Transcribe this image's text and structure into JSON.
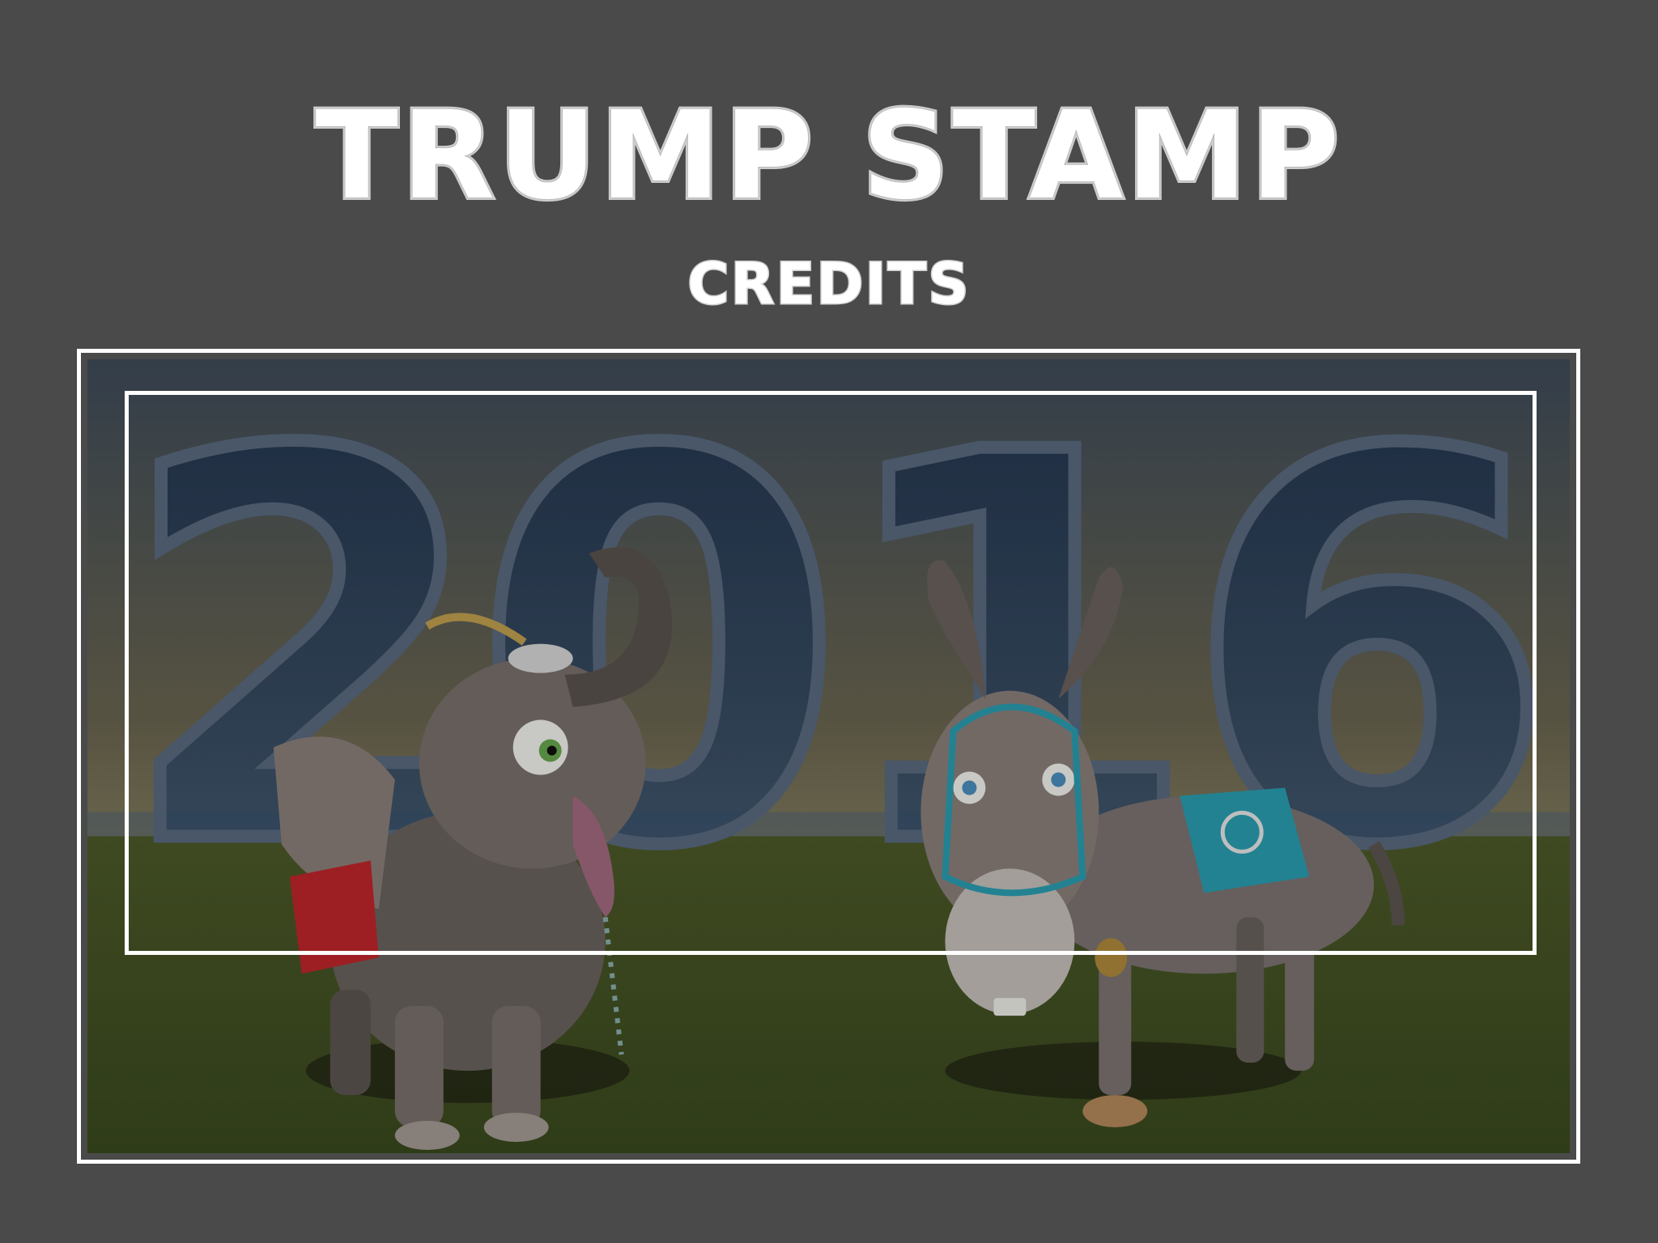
{
  "header": {
    "title": "TRUMP STAMP",
    "subtitle": "CREDITS"
  },
  "scene": {
    "year": "2016"
  },
  "colors": {
    "background": "#4a4a4a",
    "frame": "#ffffff",
    "republican_red": "#c0262b",
    "democrat_teal": "#2a9fb3"
  }
}
